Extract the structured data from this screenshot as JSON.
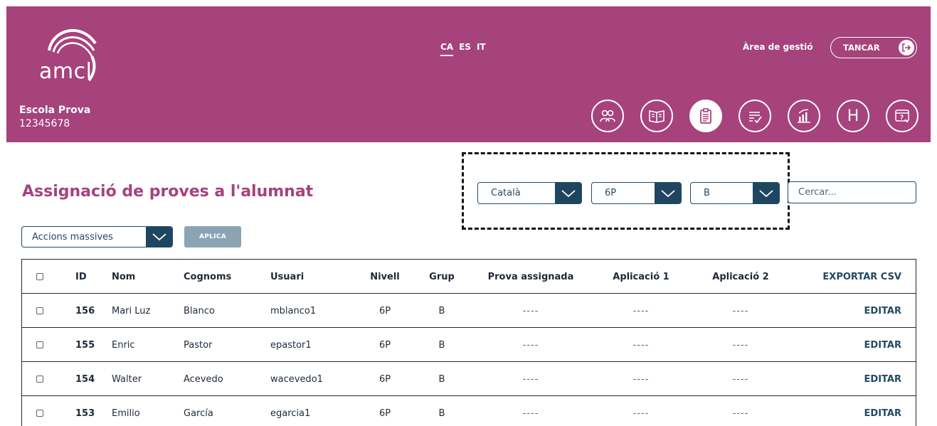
{
  "brand": {
    "logo_text": "amcl",
    "primary_color": "#a6427c",
    "accent_color": "#1f4660"
  },
  "header": {
    "languages": [
      {
        "code": "CA",
        "active": true
      },
      {
        "code": "ES",
        "active": false
      },
      {
        "code": "IT",
        "active": false
      }
    ],
    "area_label": "Àrea de gestió",
    "logout_label": "TANCAR",
    "school_name": "Escola Prova",
    "school_code": "12345678",
    "nav_icons": [
      "users-icon",
      "book-icon",
      "clipboard-icon",
      "checklist-icon",
      "chart-icon",
      "h-icon",
      "help-icon"
    ],
    "nav_active_index": 2,
    "h_letter": "H"
  },
  "page": {
    "title": "Assignació de proves a l'alumnat"
  },
  "filters": {
    "language": "Català",
    "level": "6P",
    "group": "B",
    "search_placeholder": "Cercar..."
  },
  "bulk": {
    "select_label": "Accions massives",
    "apply_label": "APLICA"
  },
  "table": {
    "columns": [
      "ID",
      "Nom",
      "Cognoms",
      "Usuari",
      "Nivell",
      "Grup",
      "Prova assignada",
      "Aplicació 1",
      "Aplicació 2"
    ],
    "export_label": "EXPORTAR CSV",
    "edit_label": "EDITAR",
    "rows": [
      {
        "id": "156",
        "nom": "Mari Luz",
        "cognoms": "Blanco",
        "usuari": "mblanco1",
        "nivell": "6P",
        "grup": "B",
        "prova": "----",
        "app1": "----",
        "app2": "----"
      },
      {
        "id": "155",
        "nom": "Enric",
        "cognoms": "Pastor",
        "usuari": "epastor1",
        "nivell": "6P",
        "grup": "B",
        "prova": "----",
        "app1": "----",
        "app2": "----"
      },
      {
        "id": "154",
        "nom": "Walter",
        "cognoms": "Acevedo",
        "usuari": "wacevedo1",
        "nivell": "6P",
        "grup": "B",
        "prova": "----",
        "app1": "----",
        "app2": "----"
      },
      {
        "id": "153",
        "nom": "Emilio",
        "cognoms": "García",
        "usuari": "egarcia1",
        "nivell": "6P",
        "grup": "B",
        "prova": "----",
        "app1": "----",
        "app2": "----"
      }
    ]
  }
}
